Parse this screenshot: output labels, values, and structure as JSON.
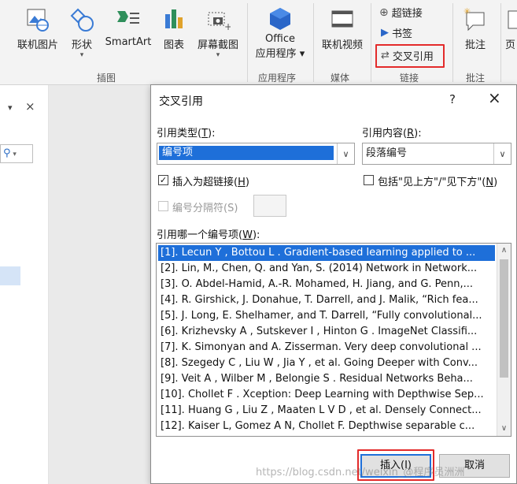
{
  "ribbon": {
    "buttons": {
      "online_pictures": "联机图片",
      "shapes": "形状",
      "smartart": "SmartArt",
      "chart": "图表",
      "screenshot": "屏幕截图",
      "office_apps_line1": "Office",
      "office_apps_line2": "应用程序",
      "online_video": "联机视频",
      "hyperlink": "超链接",
      "bookmark": "书签",
      "cross_reference": "交叉引用",
      "comment": "批注",
      "partial": "页"
    },
    "groups": {
      "illustrations": "插图",
      "apps": "应用程序",
      "media": "媒体",
      "links": "链接",
      "comments": "批注"
    },
    "accent": "#e32b2b"
  },
  "leftpane": {
    "close": "×",
    "menu": "▾",
    "search_icon": "search-icon"
  },
  "dialog": {
    "title": "交叉引用",
    "help": "?",
    "close": "×",
    "ref_type_label": "引用类型(",
    "ref_type_key": "T",
    "ref_type_tail": "):",
    "ref_type_value": "编号项",
    "ref_content_label": "引用内容(",
    "ref_content_key": "R",
    "ref_content_tail": "):",
    "ref_content_value": "段落编号",
    "insert_hyperlink_label": "插入为超链接(",
    "insert_hyperlink_key": "H",
    "insert_hyperlink_tail": ")",
    "insert_hyperlink_checked": true,
    "include_above_below_label": "包括\"见上方\"/\"见下方\"(",
    "include_above_below_key": "N",
    "include_above_below_tail": ")",
    "separator_label": "编号分隔符(S)",
    "list_label": "引用哪一个编号项(",
    "list_key": "W",
    "list_tail": "):",
    "items": [
      "[1]. Lecun Y , Bottou L . Gradient-based learning applied to ...",
      "[2]. Lin, M., Chen, Q. and Yan, S. (2014) Network in Network...",
      "[3]. O. Abdel-Hamid, A.-R. Mohamed, H. Jiang, and G. Penn,...",
      "[4]. R. Girshick, J. Donahue, T. Darrell, and J. Malik, “Rich fea...",
      "[5]. J. Long, E. Shelhamer, and T. Darrell, “Fully convolutional...",
      "[6]. Krizhevsky A , Sutskever I , Hinton G . ImageNet Classifi...",
      "[7]. K. Simonyan and A. Zisserman. Very deep convolutional ...",
      "[8]. Szegedy C , Liu W , Jia Y , et al. Going Deeper with Conv...",
      "[9]. Veit A , Wilber M , Belongie S . Residual Networks Beha...",
      "[10]. Chollet F . Xception: Deep Learning with Depthwise Sep...",
      "[11]. Huang G , Liu Z , Maaten L V D , et al. Densely Connect...",
      "[12]. Kaiser L, Gomez A N, Chollet F. Depthwise separable c..."
    ],
    "insert_button": "插入(I)",
    "cancel_button": "取消"
  },
  "watermark": "https://blog.csdn.net/weixin_@程序员洲洲"
}
